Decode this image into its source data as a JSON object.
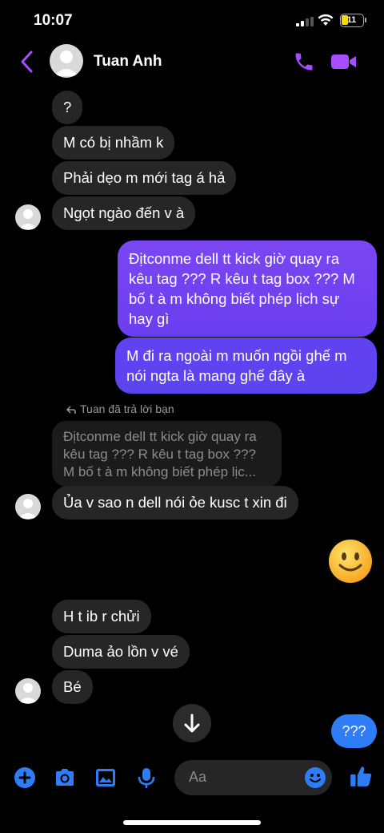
{
  "status_bar": {
    "time": "10:07",
    "battery": "11"
  },
  "header": {
    "contact_name": "Tuan Anh"
  },
  "messages": {
    "m1": "?",
    "m2": "M có bị nhầm k",
    "m3": "Phải dẹo m mới tag á hả",
    "m4": "Ngọt ngào đến v à",
    "s1_lines": [
      "Địtconme dell tt kick giờ quay ra",
      "kêu tag ??? R kêu t tag box ??? M",
      "bố t à m không biết phép lịch sự",
      "hay gì"
    ],
    "s2_lines": [
      "M đi ra ngoài m muốn ngồi ghế m",
      "nói ngta là mang ghế đây à"
    ],
    "reply_label": "Tuan đã trả lời bạn",
    "quoted_lines": [
      "Địtconme dell tt kick giờ quay ra",
      "kêu tag ??? R kêu t tag box ???",
      "M bố t à m không biết phép lịc..."
    ],
    "m5": "Ủa v sao n dell nói ỏe kusc t xin đi",
    "m6": "H t ib r chửi",
    "m7": "Duma ảo lồn v vé",
    "m8": "Bé",
    "s3": "???"
  },
  "composer": {
    "placeholder": "Aa"
  },
  "icons": {
    "back": "chevron-left-icon",
    "call": "phone-icon",
    "video": "video-camera-icon",
    "add": "plus-circle-icon",
    "camera": "camera-icon",
    "gallery": "image-icon",
    "mic": "microphone-icon",
    "emoji": "smiley-icon",
    "like": "thumbs-up-icon",
    "scroll": "arrow-down-icon"
  },
  "colors": {
    "accent": "#a64dff",
    "sent_bubble": "#6a3ef0",
    "received_bubble": "#262626",
    "blue": "#2e7cf6",
    "background": "#000000"
  }
}
